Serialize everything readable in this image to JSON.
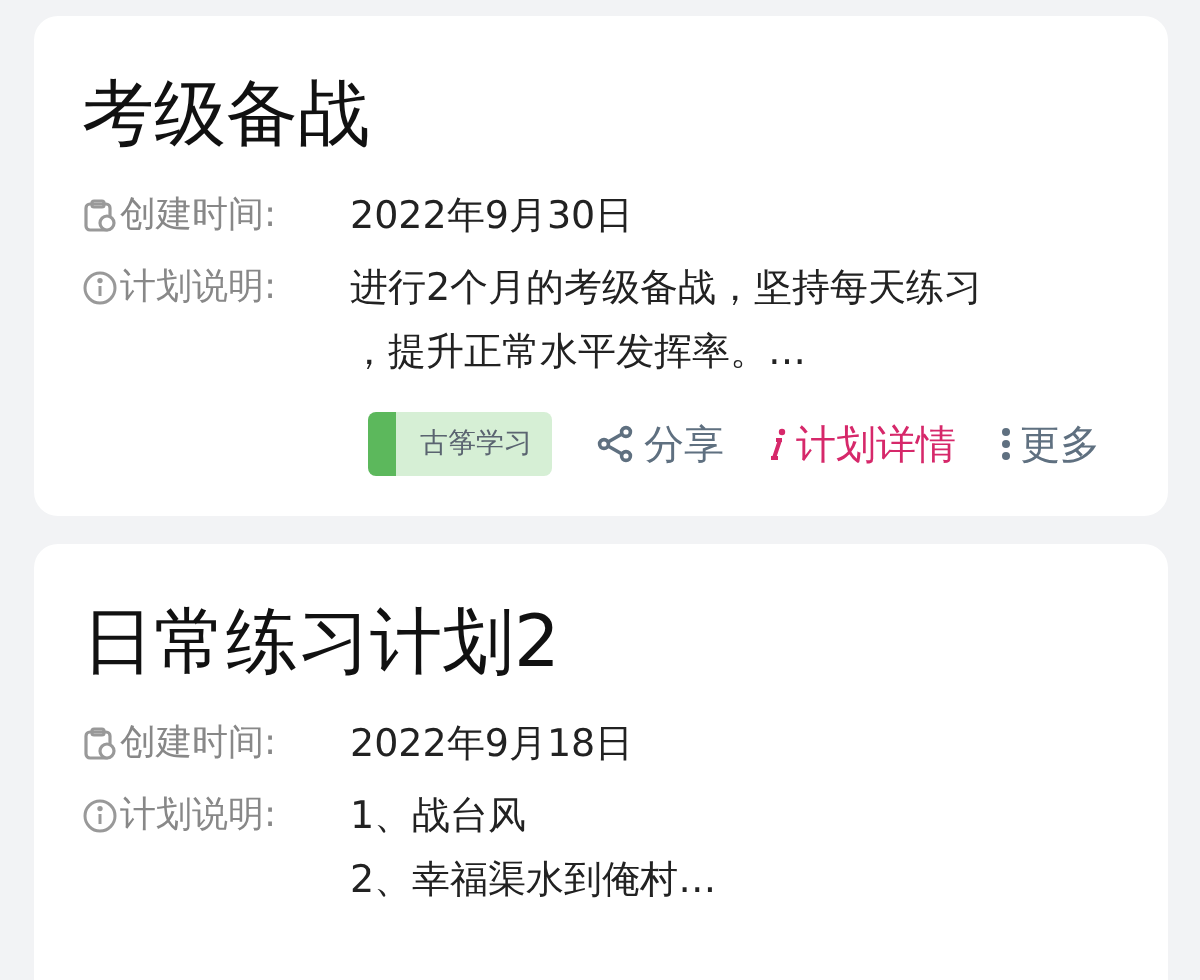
{
  "plans": [
    {
      "title": "考级备战",
      "created_label": "创建时间:",
      "created": "2022年9月30日",
      "desc_label": "计划说明:",
      "desc_lines": [
        "进行2个月的考级备战，坚持每天练习",
        "，提升正常水平发挥率。…"
      ],
      "tag": "古筝学习",
      "actions": [
        {
          "kind": "share",
          "label": "分享"
        },
        {
          "kind": "details",
          "label": "计划详情"
        },
        {
          "kind": "more",
          "label": "更多"
        }
      ]
    },
    {
      "title": "日常练习计划2",
      "created_label": "创建时间:",
      "created": "2022年9月18日",
      "desc_label": "计划说明:",
      "desc_lines": [
        "1、战台风",
        "2、幸福渠水到俺村…"
      ]
    }
  ]
}
